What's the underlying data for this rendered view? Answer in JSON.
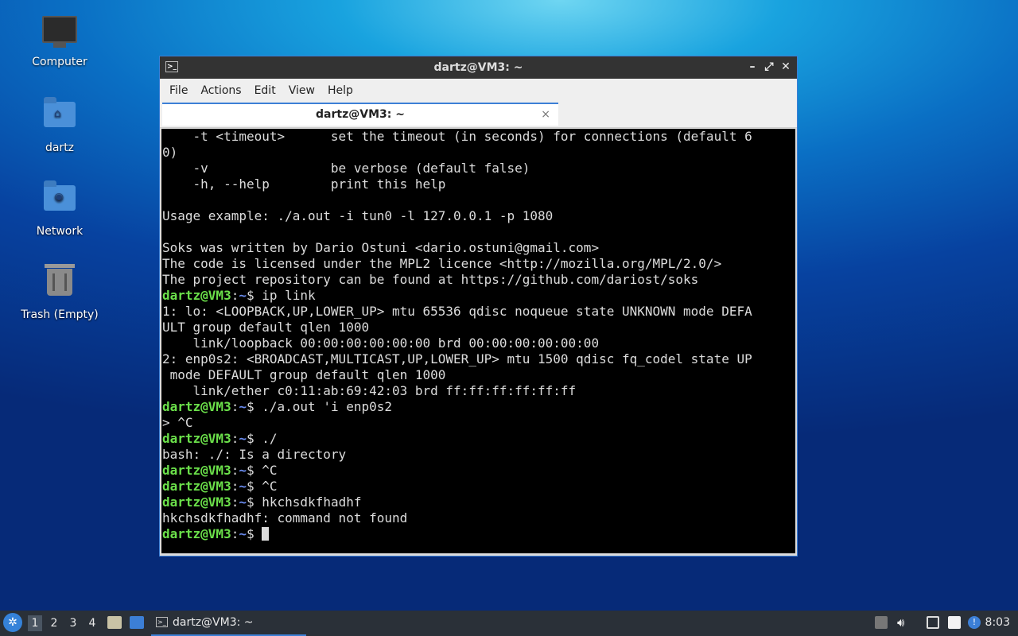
{
  "desktop": {
    "icons": [
      {
        "label": "Computer"
      },
      {
        "label": "dartz"
      },
      {
        "label": "Network"
      },
      {
        "label": "Trash (Empty)"
      }
    ]
  },
  "window": {
    "title": "dartz@VM3: ~",
    "menu": [
      "File",
      "Actions",
      "Edit",
      "View",
      "Help"
    ],
    "tab_title": "dartz@VM3: ~",
    "tab_close": "×",
    "minimize": "–",
    "maximize": "⤢",
    "close": "✕"
  },
  "terminal": {
    "prompt_user": "dartz@VM3",
    "prompt_sep": ":",
    "prompt_path": "~",
    "prompt_end": "$ ",
    "lines": [
      {
        "text": "    -t <timeout>      set the timeout (in seconds) for connections (default 6"
      },
      {
        "text": "0)"
      },
      {
        "text": "    -v                be verbose (default false)"
      },
      {
        "text": "    -h, --help        print this help"
      },
      {
        "text": ""
      },
      {
        "text": "Usage example: ./a.out -i tun0 -l 127.0.0.1 -p 1080"
      },
      {
        "text": ""
      },
      {
        "text": "Soks was written by Dario Ostuni <dario.ostuni@gmail.com>"
      },
      {
        "text": "The code is licensed under the MPL2 licence <http://mozilla.org/MPL/2.0/>"
      },
      {
        "text": "The project repository can be found at https://github.com/dariost/soks"
      },
      {
        "prompt": true,
        "text": "ip link"
      },
      {
        "text": "1: lo: <LOOPBACK,UP,LOWER_UP> mtu 65536 qdisc noqueue state UNKNOWN mode DEFA"
      },
      {
        "text": "ULT group default qlen 1000"
      },
      {
        "text": "    link/loopback 00:00:00:00:00:00 brd 00:00:00:00:00:00"
      },
      {
        "text": "2: enp0s2: <BROADCAST,MULTICAST,UP,LOWER_UP> mtu 1500 qdisc fq_codel state UP"
      },
      {
        "text": " mode DEFAULT group default qlen 1000"
      },
      {
        "text": "    link/ether c0:11:ab:69:42:03 brd ff:ff:ff:ff:ff:ff"
      },
      {
        "prompt": true,
        "text": "./a.out 'i enp0s2"
      },
      {
        "text": "> ^C"
      },
      {
        "prompt": true,
        "text": "./"
      },
      {
        "text": "bash: ./: Is a directory"
      },
      {
        "prompt": true,
        "text": "^C"
      },
      {
        "prompt": true,
        "text": "^C"
      },
      {
        "prompt": true,
        "text": "hkchsdkfhadhf"
      },
      {
        "text": "hkchsdkfhadhf: command not found"
      },
      {
        "prompt": true,
        "text": "",
        "cursor": true
      }
    ]
  },
  "taskbar": {
    "workspaces": [
      "1",
      "2",
      "3",
      "4"
    ],
    "active_workspace": "1",
    "task_label": "dartz@VM3: ~",
    "clock": "8:03"
  }
}
